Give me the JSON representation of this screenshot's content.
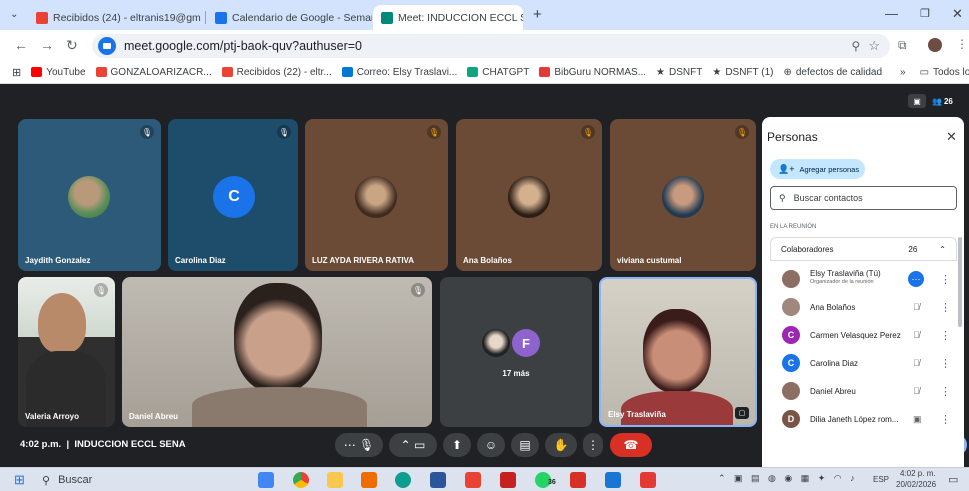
{
  "tabs": [
    {
      "title": "Recibidos (24) - eltranis19@gm",
      "color": "#ea4335"
    },
    {
      "title": "Calendario de Google - Seman",
      "color": "#1a73e8"
    },
    {
      "title": "Meet: INDUCCION ECCL SE",
      "color": "#00897b"
    }
  ],
  "address": {
    "url": "meet.google.com/ptj-baok-quv?authuser=0"
  },
  "bookmarks": [
    {
      "label": "YouTube",
      "color": "#ff0000"
    },
    {
      "label": "GONZALOARIZACR...",
      "color": "#ea4335"
    },
    {
      "label": "Recibidos (22) - eltr...",
      "color": "#ea4335"
    },
    {
      "label": "Correo: Elsy Traslavi...",
      "color": "#0078d4"
    },
    {
      "label": "CHATGPT",
      "color": "#10a37f"
    },
    {
      "label": "BibGuru NORMAS...",
      "color": "#e53935"
    },
    {
      "label": "DSNFT",
      "color": "#5f6368"
    },
    {
      "label": "DSNFT (1)",
      "color": "#5f6368"
    },
    {
      "label": "defectos de calidad",
      "color": "#5f6368"
    },
    {
      "label": "Todos los marcadores",
      "color": "#5f6368"
    }
  ],
  "meet": {
    "participant_count": "26",
    "tiles_top": [
      {
        "name": "Jaydith Gonzalez",
        "bg": "#2d5a78"
      },
      {
        "name": "Carolina Diaz",
        "bg": "#1e4d6b",
        "initial": "C"
      },
      {
        "name": "LUZ AYDA RIVERA RATIVA",
        "bg": "#6b4a36"
      },
      {
        "name": "Ana Bolaños",
        "bg": "#6b4a36"
      },
      {
        "name": "viviana custumal",
        "bg": "#6b4a36"
      }
    ],
    "tiles_bottom": [
      {
        "name": "Valeria Arroyo"
      },
      {
        "name": "Daniel Abreu"
      },
      {
        "name": "17 más",
        "initial": "F"
      },
      {
        "name": "Elsy Traslaviña"
      }
    ],
    "meeting_info": "4:02 p.m.  |  INDUCCION ECCL SENA"
  },
  "panel": {
    "title": "Personas",
    "add_label": "Agregar personas",
    "search_placeholder": "Buscar contactos",
    "section_label": "EN LA REUNIÓN",
    "group_label": "Colaboradores",
    "group_count": "26",
    "people": [
      {
        "name": "Elsy Traslaviña (Tú)",
        "sub": "Organizador de la reunión",
        "color": "#8d6e63"
      },
      {
        "name": "Ana Bolaños",
        "sub": "",
        "color": "#a1887f"
      },
      {
        "name": "Carmen Velasquez Perez",
        "sub": "",
        "color": "#9c27b0",
        "initial": "C"
      },
      {
        "name": "Carolina Diaz",
        "sub": "",
        "color": "#1a73e8",
        "initial": "C"
      },
      {
        "name": "Daniel Abreu",
        "sub": "",
        "color": "#8d6e63"
      },
      {
        "name": "Dilia Janeth López rom...",
        "sub": "",
        "color": "#795548",
        "initial": "D"
      }
    ]
  },
  "taskbar": {
    "search_label": "Buscar",
    "lang": "ESP",
    "time": "4:02 p. m.",
    "date": "20/02/2026",
    "badge": "36"
  }
}
